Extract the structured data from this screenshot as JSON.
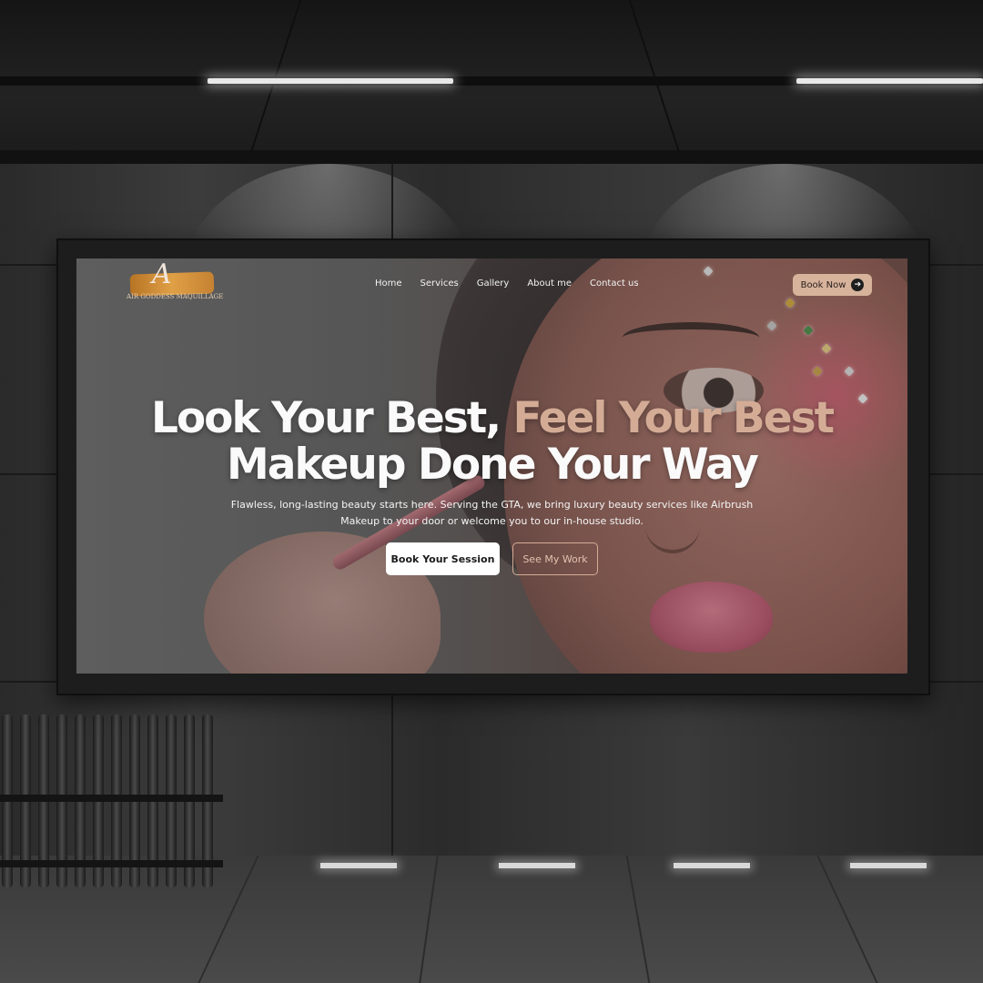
{
  "brand": {
    "monogram": "A",
    "logo_text": "AIR GODDESS MAQUILLAGE"
  },
  "nav": {
    "items": [
      "Home",
      "Services",
      "Gallery",
      "About me",
      "Contact us"
    ],
    "book_now": "Book Now",
    "book_now_icon": "arrow-right-icon"
  },
  "hero": {
    "headline_part1": "Look Your Best, ",
    "headline_accent": "Feel Your Best",
    "headline_line2": "Makeup Done Your Way",
    "description": "Flawless, long-lasting beauty starts here. Serving the GTA, we bring luxury beauty services like Airbrush Makeup to your door or welcome you to our in-house studio.",
    "primary_cta": "Book Your Session",
    "secondary_cta": "See My Work"
  },
  "colors": {
    "accent": "#d4ac96",
    "button_primary_bg": "#ffffff",
    "book_now_bg": "#d7b39c"
  }
}
